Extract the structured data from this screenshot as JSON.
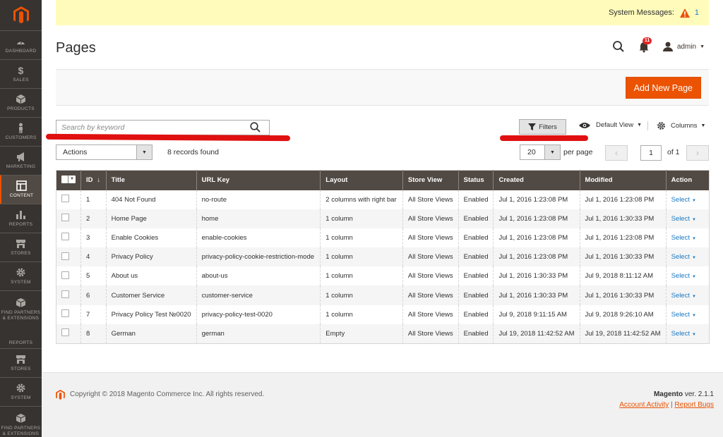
{
  "sidebar": {
    "items": [
      {
        "label": "DASHBOARD",
        "icon": "dashboard-icon"
      },
      {
        "label": "SALES",
        "icon": "dollar-icon"
      },
      {
        "label": "PRODUCTS",
        "icon": "cube-icon"
      },
      {
        "label": "CUSTOMERS",
        "icon": "person-icon"
      },
      {
        "label": "MARKETING",
        "icon": "megaphone-icon"
      },
      {
        "label": "CONTENT",
        "icon": "layout-icon"
      },
      {
        "label": "REPORTS",
        "icon": "bar-chart-icon"
      },
      {
        "label": "STORES",
        "icon": "store-icon"
      },
      {
        "label": "SYSTEM",
        "icon": "gear-icon"
      },
      {
        "label": "FIND PARTNERS & EXTENSIONS",
        "icon": "box-icon"
      },
      {
        "label": "REPORTS",
        "icon": "bar-chart-icon"
      },
      {
        "label": "STORES",
        "icon": "store-icon"
      },
      {
        "label": "SYSTEM",
        "icon": "gear-icon"
      },
      {
        "label": "FIND PARTNERS & EXTENSIONS",
        "icon": "box-icon"
      }
    ],
    "active": "CONTENT"
  },
  "system_messages": {
    "label": "System Messages:",
    "count": "1"
  },
  "header": {
    "title": "Pages",
    "notifications": "11",
    "user": "admin"
  },
  "toolbar": {
    "add_button": "Add New Page",
    "search_placeholder": "Search by keyword",
    "filters": "Filters",
    "view": "Default View",
    "columns": "Columns",
    "actions": "Actions",
    "records": "8 records found",
    "per_page_value": "20",
    "per_page_label": "per page",
    "page": "1",
    "of_pages": "of 1"
  },
  "table": {
    "headers": [
      "ID",
      "Title",
      "URL Key",
      "Layout",
      "Store View",
      "Status",
      "Created",
      "Modified",
      "Action"
    ],
    "rows": [
      {
        "id": "1",
        "title": "404 Not Found",
        "url": "no-route",
        "layout": "2 columns with right bar",
        "store": "All Store Views",
        "status": "Enabled",
        "created": "Jul 1, 2016 1:23:08 PM",
        "modified": "Jul 1, 2016 1:23:08 PM",
        "action": "Select"
      },
      {
        "id": "2",
        "title": "Home Page",
        "url": "home",
        "layout": "1 column",
        "store": "All Store Views",
        "status": "Enabled",
        "created": "Jul 1, 2016 1:23:08 PM",
        "modified": "Jul 1, 2016 1:30:33 PM",
        "action": "Select"
      },
      {
        "id": "3",
        "title": "Enable Cookies",
        "url": "enable-cookies",
        "layout": "1 column",
        "store": "All Store Views",
        "status": "Enabled",
        "created": "Jul 1, 2016 1:23:08 PM",
        "modified": "Jul 1, 2016 1:23:08 PM",
        "action": "Select"
      },
      {
        "id": "4",
        "title": "Privacy Policy",
        "url": "privacy-policy-cookie-restriction-mode",
        "layout": "1 column",
        "store": "All Store Views",
        "status": "Enabled",
        "created": "Jul 1, 2016 1:23:08 PM",
        "modified": "Jul 1, 2016 1:30:33 PM",
        "action": "Select"
      },
      {
        "id": "5",
        "title": "About us",
        "url": "about-us",
        "layout": "1 column",
        "store": "All Store Views",
        "status": "Enabled",
        "created": "Jul 1, 2016 1:30:33 PM",
        "modified": "Jul 9, 2018 8:11:12 AM",
        "action": "Select"
      },
      {
        "id": "6",
        "title": "Customer Service",
        "url": "customer-service",
        "layout": "1 column",
        "store": "All Store Views",
        "status": "Enabled",
        "created": "Jul 1, 2016 1:30:33 PM",
        "modified": "Jul 1, 2016 1:30:33 PM",
        "action": "Select"
      },
      {
        "id": "7",
        "title": "Privacy Policy Test №0020",
        "url": "privacy-policy-test-0020",
        "layout": "1 column",
        "store": "All Store Views",
        "status": "Enabled",
        "created": "Jul 9, 2018 9:11:15 AM",
        "modified": "Jul 9, 2018 9:26:10 AM",
        "action": "Select"
      },
      {
        "id": "8",
        "title": "German",
        "url": "german",
        "layout": "Empty",
        "store": "All Store Views",
        "status": "Enabled",
        "created": "Jul 19, 2018 11:42:52 AM",
        "modified": "Jul 19, 2018 11:42:52 AM",
        "action": "Select"
      }
    ]
  },
  "footer": {
    "copyright": "Copyright © 2018 Magento Commerce Inc. All rights reserved.",
    "brand": "Magento",
    "version": " ver. 2.1.1",
    "account_activity": "Account Activity",
    "separator": " | ",
    "report_bugs": "Report Bugs"
  },
  "colors": {
    "accent": "#eb5202",
    "sidebar": "#373330",
    "table_header": "#514943",
    "link": "#1979c3",
    "annotation": "#e01010"
  }
}
